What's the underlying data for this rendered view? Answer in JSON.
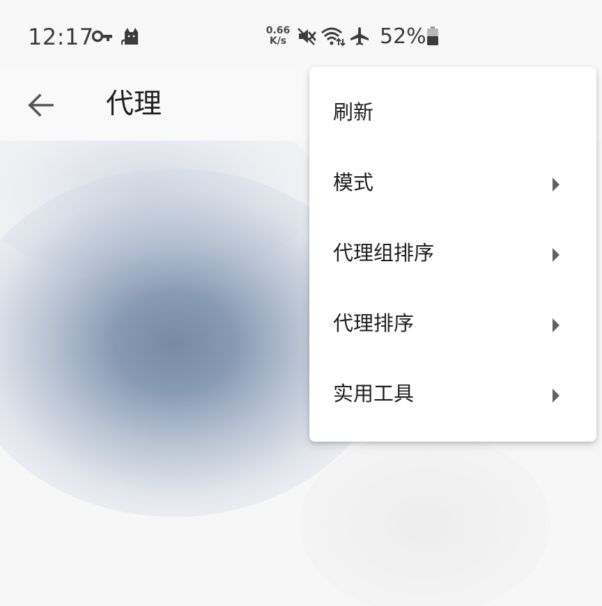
{
  "status_bar": {
    "time": "12:17",
    "net_speed_value": "0.66",
    "net_speed_unit": "K/s",
    "battery_percent": "52%",
    "icons": [
      "vpn-key-icon",
      "clash-cat-icon",
      "mute-icon",
      "wifi-icon",
      "airplane-mode-icon",
      "battery-icon"
    ]
  },
  "toolbar": {
    "title": "代理",
    "back_icon": "arrow-left-icon"
  },
  "menu": {
    "items": [
      {
        "label": "刷新",
        "has_submenu": false
      },
      {
        "label": "模式",
        "has_submenu": true
      },
      {
        "label": "代理组排序",
        "has_submenu": true
      },
      {
        "label": "代理排序",
        "has_submenu": true
      },
      {
        "label": "实用工具",
        "has_submenu": true
      }
    ]
  },
  "colors": {
    "background": "#f8f8f8",
    "menu_background": "#ffffff",
    "text_primary": "#1e1e1e",
    "icon_gray": "#606060",
    "blur_accent": "#768aa6"
  }
}
